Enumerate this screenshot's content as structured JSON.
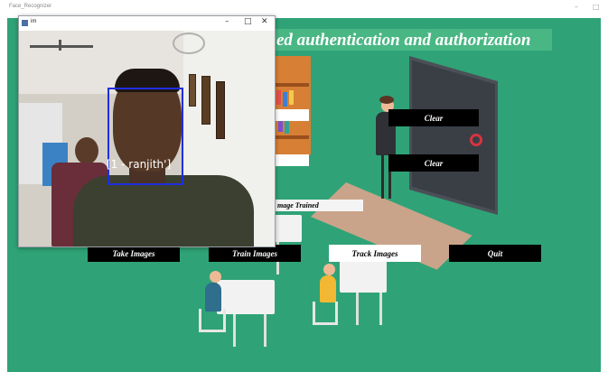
{
  "app": {
    "title": "Face_Recognizer",
    "minimize": "–",
    "maximize": "□"
  },
  "heading": {
    "visible_text": "ed authentication and authorization"
  },
  "buttons": {
    "clear_1": "Clear",
    "clear_2": "Clear",
    "take_images": "Take Images",
    "train_images": "Train Images",
    "track_images": "Track Images",
    "quit": "Quit"
  },
  "labels": {
    "status_visible": "mage Trained"
  },
  "camera_window": {
    "title": "im",
    "minimize": "–",
    "maximize": "□",
    "close": "✕",
    "face_label": "[1 - ranjith']"
  },
  "colors": {
    "background": "#2fa377",
    "heading_bar": "#49b784",
    "button_dark": "#000000",
    "button_light": "#ffffff",
    "face_box": "#1f2ee0"
  }
}
